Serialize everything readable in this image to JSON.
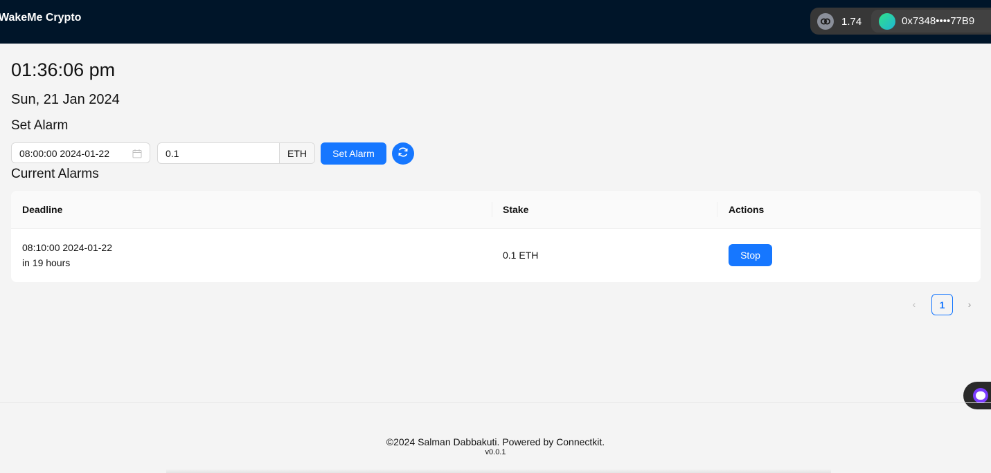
{
  "header": {
    "brand": "WakeMe Crypto",
    "wallet": {
      "balance": "1.74",
      "chain_icon": "chain-link-icon",
      "address": "0x7348••••77B9",
      "avatar_icon": "avatar-gradient"
    }
  },
  "main": {
    "time": "01:36:06 pm",
    "date": "Sun, 21 Jan 2024",
    "set_alarm_heading": "Set Alarm",
    "form": {
      "datetime_value": "08:00:00 2024-01-22",
      "stake_value": "0.1",
      "stake_unit": "ETH",
      "submit_label": "Set Alarm",
      "refresh_icon": "refresh-icon"
    },
    "current_alarms_heading": "Current Alarms",
    "table": {
      "columns": [
        "Deadline",
        "Stake",
        "Actions"
      ],
      "rows": [
        {
          "deadline": "08:10:00 2024-01-22",
          "relative": "in 19 hours",
          "stake": "0.1 ETH",
          "action_label": "Stop"
        }
      ]
    },
    "pagination": {
      "current_page": "1",
      "prev_icon": "chevron-left-icon",
      "next_icon": "chevron-right-icon"
    }
  },
  "footer": {
    "text": "©2024 Salman Dabbakuti. Powered by Connectkit.",
    "version": "v0.0.1"
  },
  "colors": {
    "header_bg": "#001529",
    "primary": "#1677ff",
    "page_bg": "#f4f4f4"
  }
}
